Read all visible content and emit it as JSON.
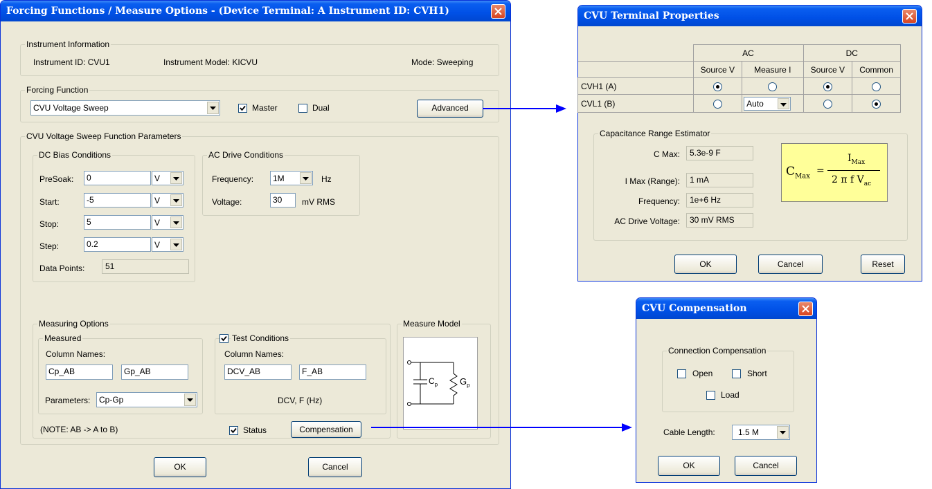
{
  "main": {
    "title": "Forcing Functions / Measure Options - (Device Terminal: A  Instrument ID: CVH1)",
    "instrument_info": {
      "legend": "Instrument Information",
      "id_text": "Instrument ID:  CVU1",
      "model_text": "Instrument Model:  KICVU",
      "mode_text": "Mode:  Sweeping"
    },
    "forcing": {
      "legend": "Forcing Function",
      "selected": "CVU Voltage Sweep",
      "master_label": "Master",
      "master_checked": true,
      "dual_label": "Dual",
      "dual_checked": false,
      "advanced_label": "Advanced"
    },
    "params": {
      "legend": "CVU Voltage Sweep Function Parameters",
      "dc_legend": "DC Bias Conditions",
      "presoak_label": "PreSoak:",
      "presoak_value": "0",
      "start_label": "Start:",
      "start_value": "-5",
      "stop_label": "Stop:",
      "stop_value": "5",
      "step_label": "Step:",
      "step_value": "0.2",
      "unit": "V",
      "datapoints_label": "Data Points:",
      "datapoints_value": "51",
      "ac_legend": "AC Drive Conditions",
      "freq_label": "Frequency:",
      "freq_value": "1M",
      "freq_unit": "Hz",
      "voltage_label": "Voltage:",
      "voltage_value": "30",
      "voltage_unit": "mV RMS"
    },
    "measuring": {
      "legend": "Measuring Options",
      "measured_legend": "Measured",
      "column_names_label": "Column Names:",
      "col1": "Cp_AB",
      "col2": "Gp_AB",
      "parameters_label": "Parameters:",
      "parameters_value": "Cp-Gp",
      "test_conditions_label": "Test Conditions",
      "test_conditions_checked": true,
      "tc_column_names_label": "Column Names:",
      "tc_col1": "DCV_AB",
      "tc_col2": "F_AB",
      "tc_note": "DCV, F (Hz)",
      "note": "(NOTE: AB -> A to B)",
      "status_label": "Status",
      "status_checked": true,
      "compensation_label": "Compensation"
    },
    "measure_model": {
      "legend": "Measure Model",
      "cap_label": "C",
      "cap_sub": "p",
      "res_label": "G",
      "res_sub": "p"
    },
    "ok_label": "OK",
    "cancel_label": "Cancel"
  },
  "terminal": {
    "title": "CVU Terminal Properties",
    "header_ac": "AC",
    "header_dc": "DC",
    "sub_source_v": "Source V",
    "sub_measure_i": "Measure I",
    "sub_source_v2": "Source V",
    "sub_common": "Common",
    "row1_label": "CVH1 (A)",
    "row2_label": "CVL1 (B)",
    "row2_measure_i": "Auto",
    "cre_legend": "Capacitance Range Estimator",
    "cmax_label": "C Max:",
    "cmax_value": "5.3e-9 F",
    "imax_label": "I Max (Range):",
    "imax_value": "1 mA",
    "freq_label": "Frequency:",
    "freq_value": "1e+6 Hz",
    "acv_label": "AC Drive Voltage:",
    "acv_value": "30 mV RMS",
    "formula": {
      "lhs": "C",
      "lhs_sub": "Max",
      "eq": "=",
      "num": "I",
      "num_sub": "Max",
      "den": "2 π f V",
      "den_sub": "ac"
    },
    "ok_label": "OK",
    "cancel_label": "Cancel",
    "reset_label": "Reset"
  },
  "compensation": {
    "title": "CVU Compensation",
    "legend": "Connection Compensation",
    "open_label": "Open",
    "short_label": "Short",
    "load_label": "Load",
    "cable_label": "Cable Length:",
    "cable_value": "1.5 M",
    "ok_label": "OK",
    "cancel_label": "Cancel"
  },
  "colors": {
    "titlebar": "#0054e3",
    "dialog_bg": "#ece9d8",
    "arrow": "#0000ff",
    "formula_bg": "#ffff99"
  }
}
